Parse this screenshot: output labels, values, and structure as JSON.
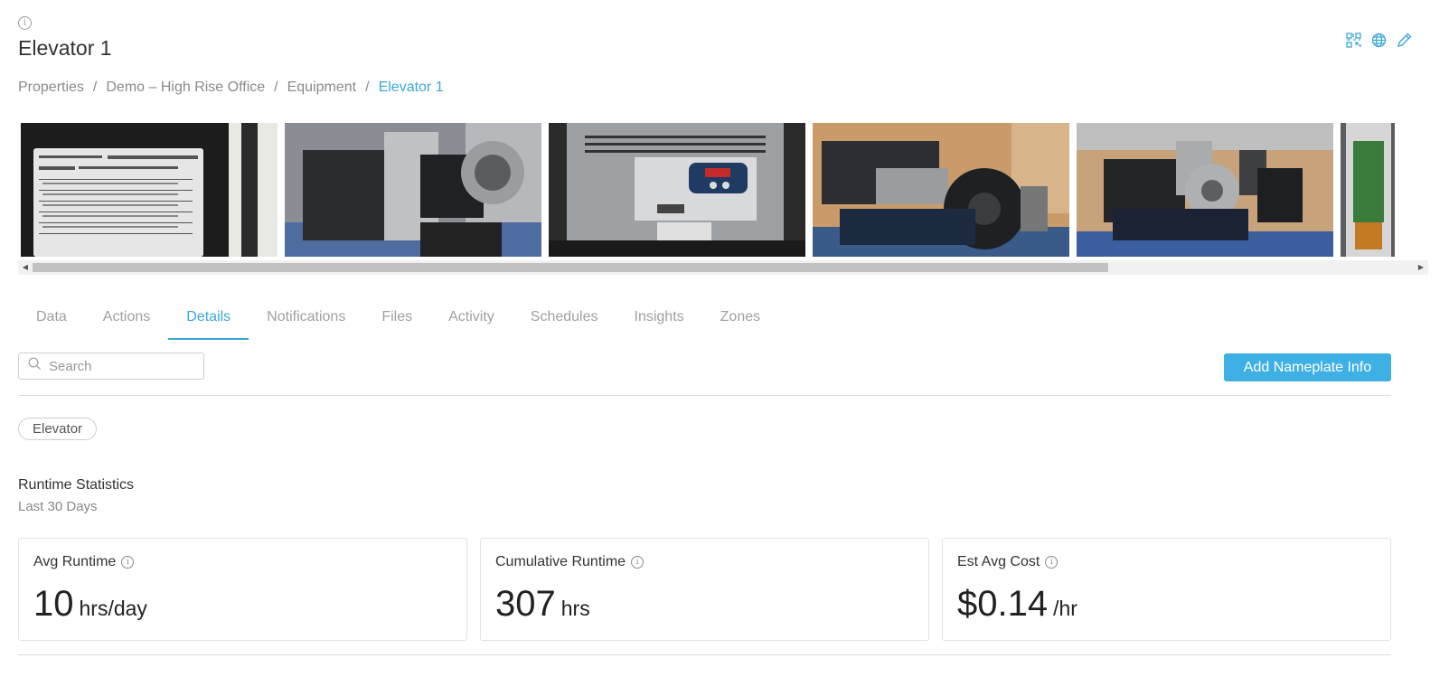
{
  "header": {
    "title": "Elevator 1",
    "actions": [
      {
        "icon": "qr-code-icon"
      },
      {
        "icon": "globe-icon"
      },
      {
        "icon": "pencil-icon"
      }
    ]
  },
  "breadcrumb": {
    "items": [
      "Properties",
      "Demo – High Rise Office",
      "Equipment"
    ],
    "current": "Elevator 1",
    "separator": "/"
  },
  "gallery": {
    "photos": [
      {
        "name": "nameplate-label-photo"
      },
      {
        "name": "motor-side-photo"
      },
      {
        "name": "drive-controller-photo"
      },
      {
        "name": "machine-room-photo"
      },
      {
        "name": "elevator-machine-photo"
      },
      {
        "name": "control-cabinet-photo"
      }
    ]
  },
  "tabs": {
    "items": [
      "Data",
      "Actions",
      "Details",
      "Notifications",
      "Files",
      "Activity",
      "Schedules",
      "Insights",
      "Zones"
    ],
    "active": "Details"
  },
  "toolbar": {
    "search_placeholder": "Search",
    "add_button": "Add Nameplate Info"
  },
  "tag": "Elevator",
  "runtime": {
    "title": "Runtime Statistics",
    "subtitle": "Last 30 Days",
    "cards": [
      {
        "label": "Avg Runtime",
        "value": "10",
        "unit": "hrs/day"
      },
      {
        "label": "Cumulative Runtime",
        "value": "307",
        "unit": "hrs"
      },
      {
        "label": "Est Avg Cost",
        "value": "$0.14",
        "unit": "/hr"
      }
    ]
  },
  "colors": {
    "accent": "#3ba7d8",
    "button": "#3fb0e3"
  }
}
